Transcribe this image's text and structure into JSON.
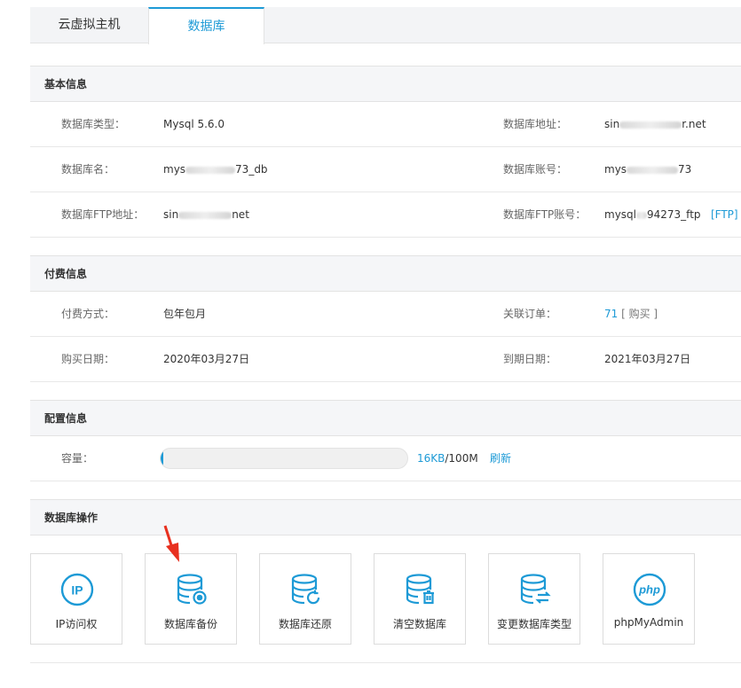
{
  "tabs": [
    {
      "label": "云虚拟主机"
    },
    {
      "label": "数据库"
    }
  ],
  "basic": {
    "title": "基本信息",
    "rows": [
      {
        "l1": "数据库类型：",
        "v1": "Mysql 5.6.0",
        "l2": "数据库地址：",
        "v2a": "sin",
        "v2b": "r.net"
      },
      {
        "l1": "数据库名：",
        "v1a": "mys",
        "v1b": "73_db",
        "l2": "数据库账号：",
        "v2a": "mys",
        "v2b": "73"
      },
      {
        "l1": "数据库FTP地址：",
        "v1a": "sin",
        "v1b": "net",
        "l2": "数据库FTP账号：",
        "v2a": "mysql",
        "v2b": "94273_ftp",
        "v2link": "[FTP]"
      }
    ]
  },
  "billing": {
    "title": "付费信息",
    "rows": [
      {
        "l1": "付费方式：",
        "v1": "包年包月",
        "l2": "关联订单：",
        "v2": "71",
        "v2extra": "[ 购买 ]"
      },
      {
        "l1": "购买日期：",
        "v1": "2020年03月27日",
        "l2": "到期日期：",
        "v2": "2021年03月27日"
      }
    ]
  },
  "config": {
    "title": "配置信息",
    "capacity_label": "容量：",
    "used": "16KB",
    "total": "/100M",
    "refresh": "刷新",
    "usage_fraction": 0.00016
  },
  "ops": {
    "title": "数据库操作",
    "items": [
      {
        "label": "IP访问权",
        "icon": "ip-icon"
      },
      {
        "label": "数据库备份",
        "icon": "database-backup-icon"
      },
      {
        "label": "数据库还原",
        "icon": "database-restore-icon"
      },
      {
        "label": "清空数据库",
        "icon": "database-clear-icon"
      },
      {
        "label": "变更数据库类型",
        "icon": "database-change-type-icon"
      },
      {
        "label": "phpMyAdmin",
        "icon": "php-icon"
      }
    ]
  },
  "colors": {
    "accent": "#1d9ad6",
    "arrow": "#e8301f"
  }
}
